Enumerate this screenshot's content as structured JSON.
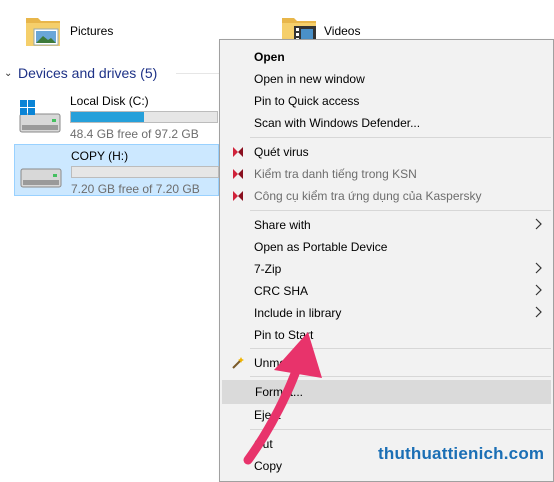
{
  "folders": [
    {
      "label": "Pictures",
      "icon": "pictures-folder-icon"
    },
    {
      "label": "Videos",
      "icon": "videos-folder-icon"
    }
  ],
  "section": {
    "title": "Devices and drives (5)"
  },
  "drives": [
    {
      "name": "Local Disk (C:)",
      "free": "48.4 GB free of 97.2 GB",
      "used_fraction": 0.5,
      "icon": "windows-drive-icon",
      "selected": false
    },
    {
      "name": "COPY (H:)",
      "free": "7.20 GB free of 7.20 GB",
      "used_fraction": 0.0,
      "icon": "usb-drive-icon",
      "selected": true
    }
  ],
  "menu": {
    "items": [
      {
        "label": "Open",
        "bold": true
      },
      {
        "label": "Open in new window"
      },
      {
        "label": "Pin to Quick access"
      },
      {
        "label": "Scan with Windows Defender..."
      },
      {
        "label": "Quét virus",
        "icon": "kaspersky-icon"
      },
      {
        "label": "Kiểm tra danh tiếng trong KSN",
        "icon": "kaspersky-icon",
        "dim": true
      },
      {
        "label": "Công cụ kiểm tra ứng dụng của Kaspersky",
        "icon": "kaspersky-icon",
        "dim": true
      },
      {
        "label": "Share with",
        "submenu": true
      },
      {
        "label": "Open as Portable Device"
      },
      {
        "label": "7-Zip",
        "submenu": true
      },
      {
        "label": "CRC SHA",
        "submenu": true
      },
      {
        "label": "Include in library",
        "submenu": true
      },
      {
        "label": "Pin to Start"
      },
      {
        "label": "Unmount",
        "icon": "magic-wand-icon"
      },
      {
        "label": "Format...",
        "highlighted": true
      },
      {
        "label": "Eject"
      },
      {
        "label": "Cut"
      },
      {
        "label": "Copy"
      }
    ]
  },
  "watermark": "thuthuattienich.com",
  "colors": {
    "accent": "#26a0da",
    "selection": "#cce8ff",
    "arrow": "#e8336b",
    "watermark": "#1b6fb5"
  }
}
